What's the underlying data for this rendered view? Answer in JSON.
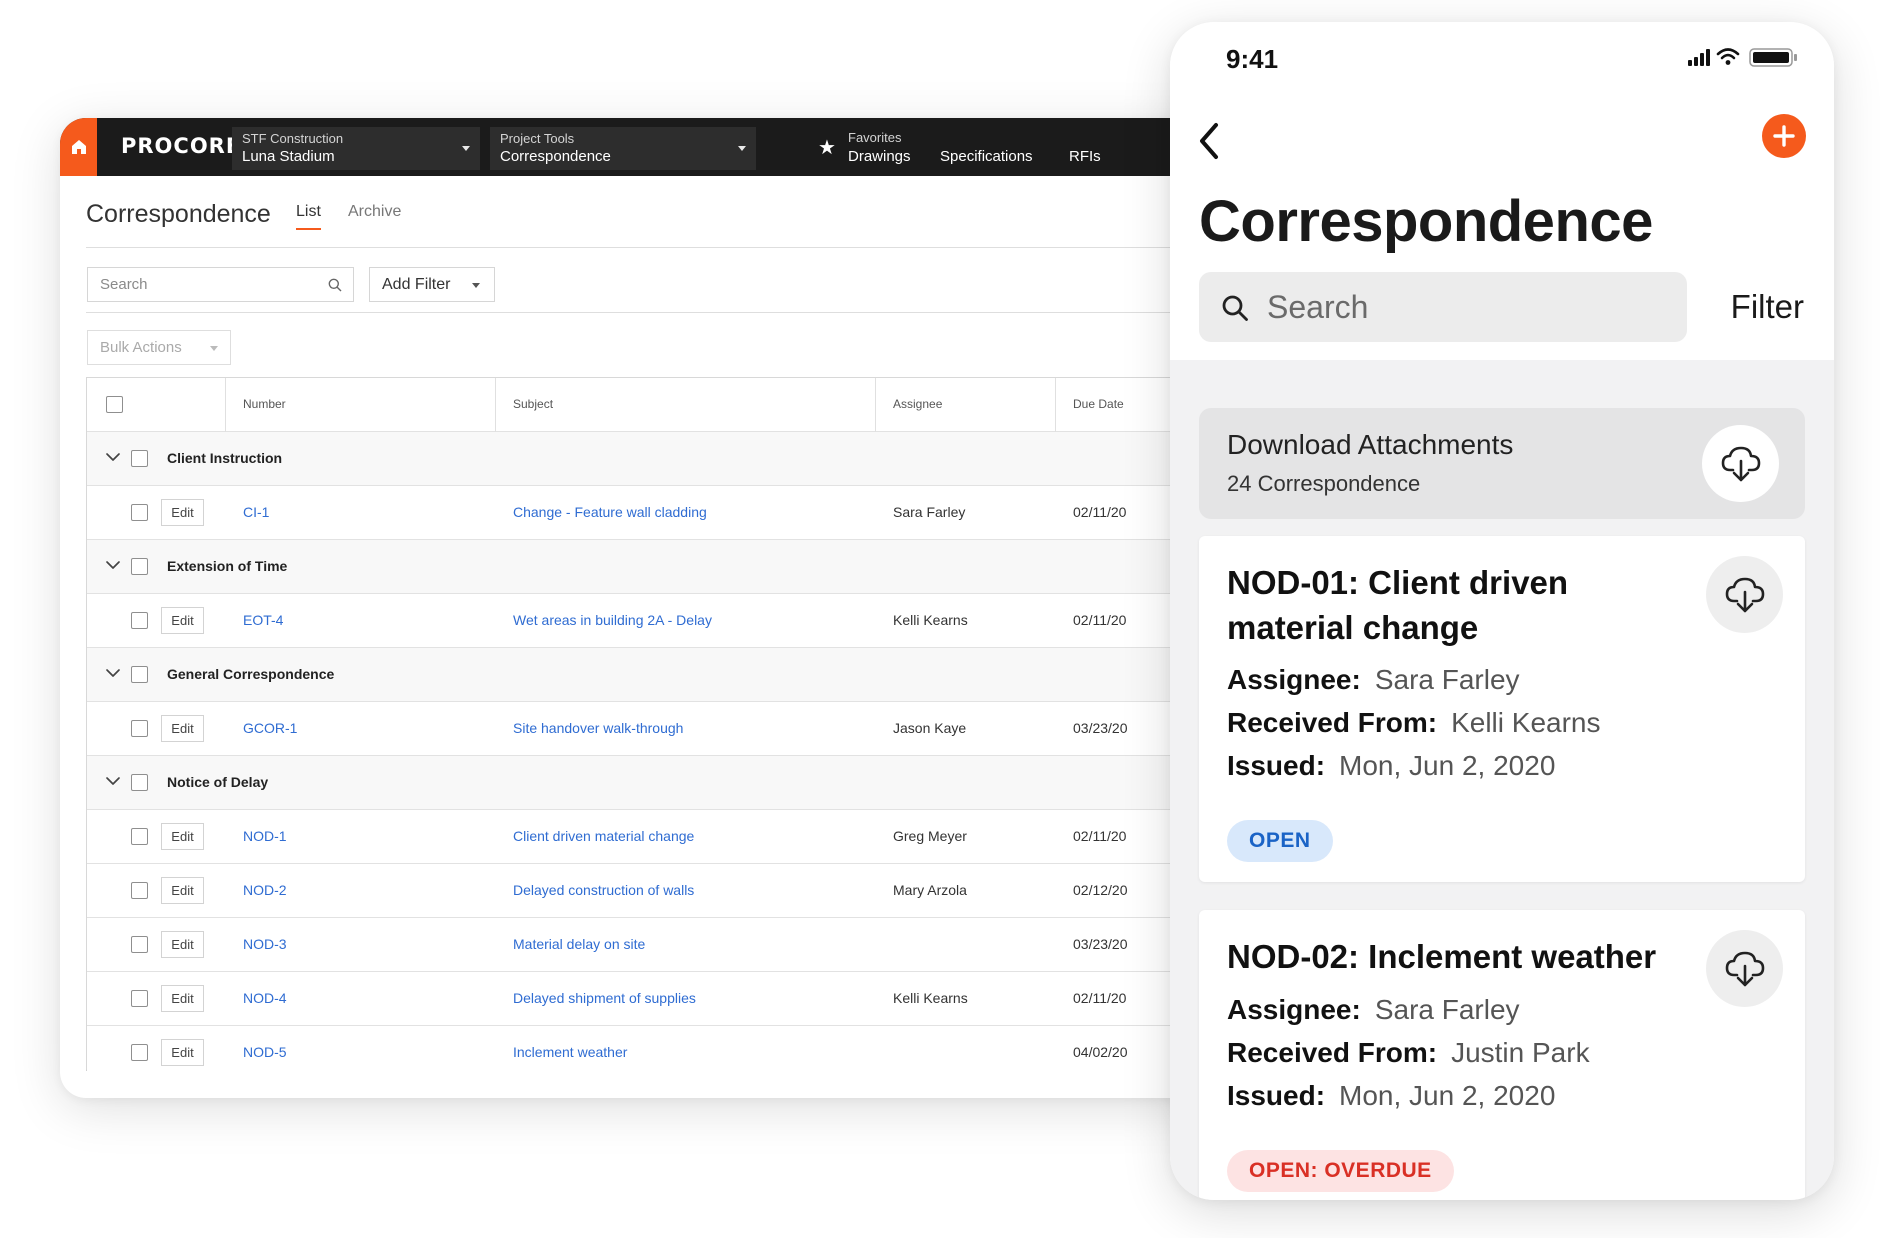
{
  "desktop": {
    "logo": "PROCORE",
    "company_select": {
      "label": "STF Construction",
      "value": "Luna Stadium"
    },
    "tools_select": {
      "label": "Project Tools",
      "value": "Correspondence"
    },
    "favorites": {
      "label": "Favorites",
      "links": [
        "Drawings",
        "Specifications",
        "RFIs"
      ]
    },
    "page_title": "Correspondence",
    "tabs": [
      "List",
      "Archive"
    ],
    "search_placeholder": "Search",
    "add_filter": "Add Filter",
    "bulk_actions": "Bulk Actions",
    "columns": [
      "Number",
      "Subject",
      "Assignee",
      "Due Date"
    ],
    "edit_label": "Edit",
    "groups": [
      {
        "name": "Client Instruction",
        "rows": [
          {
            "number": "CI-1",
            "subject": "Change - Feature wall cladding",
            "assignee": "Sara Farley",
            "due": "02/11/20"
          }
        ]
      },
      {
        "name": "Extension of Time",
        "rows": [
          {
            "number": "EOT-4",
            "subject": "Wet areas in building 2A - Delay",
            "assignee": "Kelli Kearns",
            "due": "02/11/20"
          }
        ]
      },
      {
        "name": "General Correspondence",
        "rows": [
          {
            "number": "GCOR-1",
            "subject": "Site handover walk-through",
            "assignee": "Jason Kaye",
            "due": "03/23/20"
          }
        ]
      },
      {
        "name": "Notice of Delay",
        "rows": [
          {
            "number": "NOD-1",
            "subject": "Client driven material change",
            "assignee": "Greg Meyer",
            "due": "02/11/20"
          },
          {
            "number": "NOD-2",
            "subject": "Delayed construction of walls",
            "assignee": "Mary Arzola",
            "due": "02/12/20"
          },
          {
            "number": "NOD-3",
            "subject": "Material delay on site",
            "assignee": "",
            "due": "03/23/20"
          },
          {
            "number": "NOD-4",
            "subject": "Delayed shipment of supplies",
            "assignee": "Kelli Kearns",
            "due": "02/11/20"
          },
          {
            "number": "NOD-5",
            "subject": "Inclement weather",
            "assignee": "",
            "due": "04/02/20"
          }
        ]
      }
    ]
  },
  "mobile": {
    "time": "9:41",
    "title": "Correspondence",
    "search_placeholder": "Search",
    "filter_label": "Filter",
    "download": {
      "title": "Download Attachments",
      "subtitle": "24 Correspondence"
    },
    "cards": [
      {
        "title": "NOD-01: Client driven material change",
        "assignee_label": "Assignee:",
        "assignee": "Sara Farley",
        "received_label": "Received From:",
        "received": "Kelli Kearns",
        "issued_label": "Issued:",
        "issued": "Mon, Jun 2, 2020",
        "status": "OPEN",
        "status_kind": "open"
      },
      {
        "title": "NOD-02: Inclement weather",
        "assignee_label": "Assignee:",
        "assignee": "Sara Farley",
        "received_label": "Received From:",
        "received": "Justin Park",
        "issued_label": "Issued:",
        "issued": "Mon, Jun 2, 2020",
        "status": "OPEN: OVERDUE",
        "status_kind": "overdue"
      }
    ]
  },
  "colors": {
    "brand_orange": "#f55a1c",
    "link_blue": "#2f6cd2",
    "topbar_dark": "#1b1b1b",
    "open_blue": "#1a63c6",
    "overdue_red": "#d93025"
  },
  "icons": [
    "home-icon",
    "chevron-down-icon",
    "star-icon",
    "search-icon",
    "caret-down-icon",
    "back-chevron-icon",
    "plus-icon",
    "cloud-download-icon",
    "signal-icon",
    "wifi-icon",
    "battery-icon"
  ]
}
